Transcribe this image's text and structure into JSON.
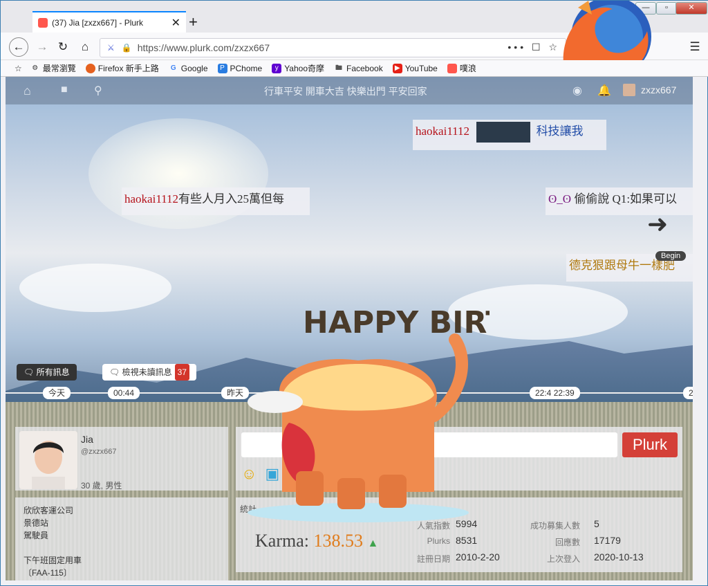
{
  "browser": {
    "tab_title": "(37) Jia [zxzx667] - Plurk",
    "new_tab": "+",
    "url": "https://www.plurk.com/zxzx667",
    "url_menu": "•••",
    "window_buttons": [
      "—",
      "▫",
      "✕"
    ],
    "bookmarks": [
      {
        "label": "最常瀏覽",
        "icon": "gear-icon"
      },
      {
        "label": "Firefox 新手上路",
        "icon": "firefox-icon"
      },
      {
        "label": "Google",
        "icon": "google-icon"
      },
      {
        "label": "PChome",
        "icon": "pchome-icon"
      },
      {
        "label": "Yahoo奇摩",
        "icon": "yahoo-icon"
      },
      {
        "label": "Facebook",
        "icon": "folder-icon"
      },
      {
        "label": "YouTube",
        "icon": "youtube-icon"
      },
      {
        "label": "噗浪",
        "icon": "plurk-icon"
      }
    ]
  },
  "topnav": {
    "slogan": "行車平安 開車大吉 快樂出門 平安回家",
    "username": "zxzx667"
  },
  "plurks": [
    {
      "name": "haokai1112",
      "text": "",
      "extra": "科技讓我"
    },
    {
      "name": "haokai1112",
      "text": "有些人月入25萬但每"
    },
    {
      "name": "ʘ_ʘ",
      "text": "偷偷說 Q1:如果可以"
    },
    {
      "name": "",
      "text": "德克狠跟母牛一樣肥"
    }
  ],
  "timeline": {
    "tags": [
      "今天",
      "00:44",
      "昨天",
      "22:4 22:39",
      "2"
    ]
  },
  "nav_controls": {
    "begin": "Begin"
  },
  "filters": {
    "all": "所有訊息",
    "unread": "檢視未讀訊息",
    "unread_count": "37"
  },
  "profile": {
    "name": "Jia",
    "handle": "@zxzx667",
    "age_gender": "30 歲, 男性",
    "bio": "欣欣客運公司\n景德站\n駕駛員\n\n下午班固定用車\n〔FAA-115〕"
  },
  "composer": {
    "submit": "Plurk"
  },
  "stats": {
    "header": "統計",
    "karma_label": "Karma:",
    "karma_value": "138.53",
    "rows": [
      {
        "label": "人氣指數",
        "value": "5994",
        "label2": "成功募集人數",
        "value2": "5"
      },
      {
        "label": "Plurks",
        "value": "8531",
        "label2": "回應數",
        "value2": "17179"
      },
      {
        "label": "註冊日期",
        "value": "2010-2-20",
        "label2": "上次登入",
        "value2": "2020-10-13"
      }
    ]
  },
  "sticker": {
    "text": "HAPPY BIRTHDAY"
  }
}
